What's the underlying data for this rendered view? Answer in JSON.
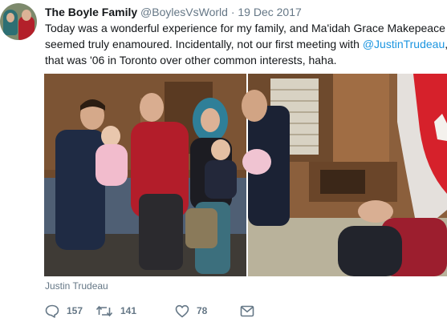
{
  "author": {
    "name": "The Boyle Family",
    "handle": "@BoylesVsWorld",
    "separator": "·",
    "date": "19 Dec 2017"
  },
  "tweet": {
    "line1": "Today was a wonderful experience for my family, and Ma'idah Grace Makepeace",
    "line2": "seemed truly enamoured. Incidentally, not our first meeting with ",
    "mention": "@JustinTrudeau",
    "line2_end": ",",
    "line3": "that was '06 in Toronto over other common interests, haha."
  },
  "media": {
    "tag": "Justin Trudeau"
  },
  "actions": {
    "replies": "157",
    "retweets": "141",
    "likes": "78"
  },
  "icons": {
    "reply": "reply-icon",
    "retweet": "retweet-icon",
    "like": "heart-icon",
    "message": "envelope-icon"
  },
  "colors": {
    "link": "#1b95e0",
    "secondary_text": "#657786",
    "text": "#14171a"
  }
}
